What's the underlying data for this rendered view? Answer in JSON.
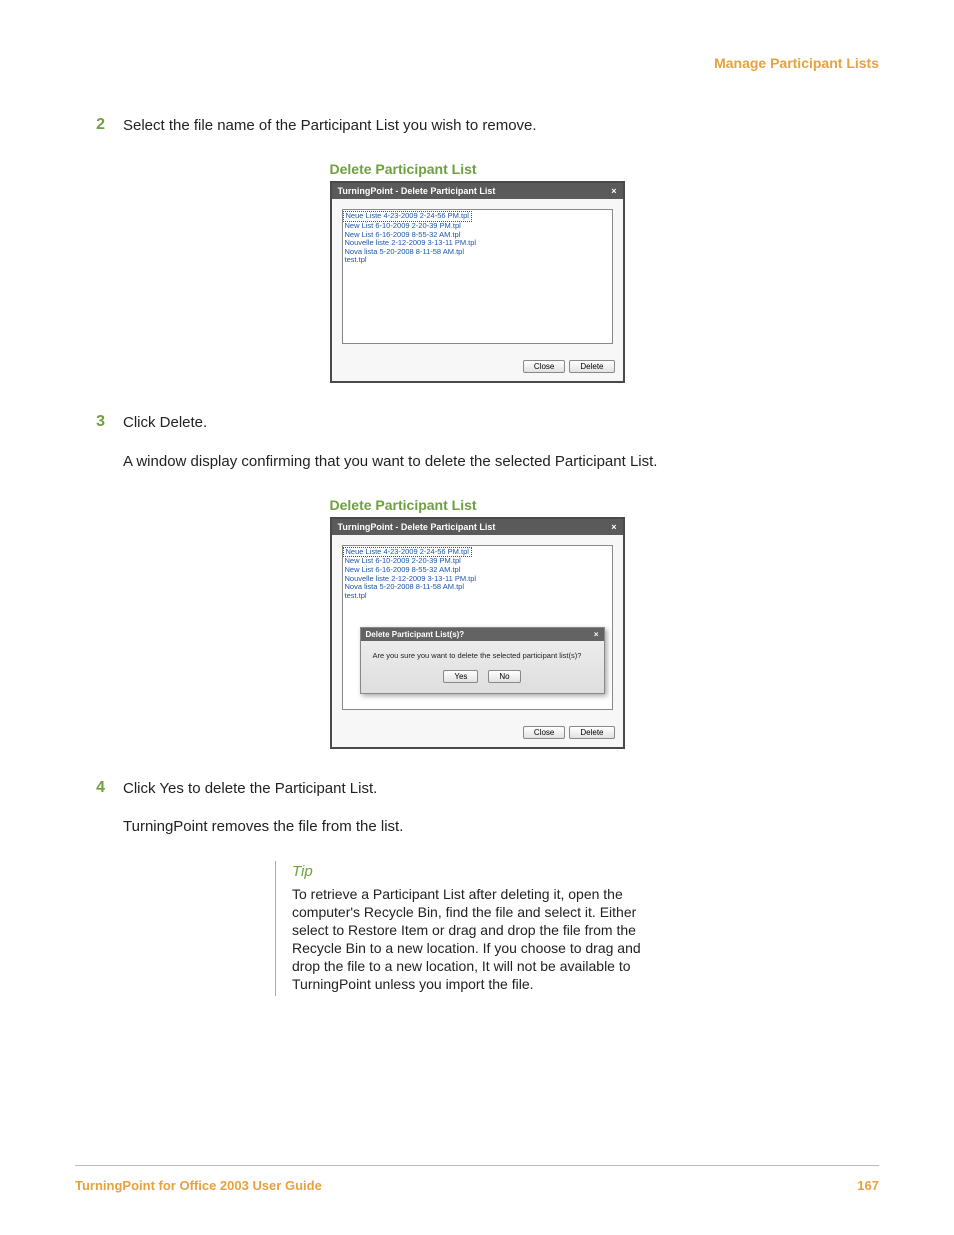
{
  "header": {
    "section_title": "Manage Participant Lists"
  },
  "steps": {
    "s2": {
      "num": "2",
      "text": "Select the file name of the Participant List you wish to remove."
    },
    "s3": {
      "num": "3",
      "text": "Click Delete."
    },
    "s3_followup": "A window display confirming that you want to delete the selected Participant List.",
    "s4": {
      "num": "4",
      "text": "Click Yes to delete the Participant List."
    },
    "s4_followup": "TurningPoint removes the file from the list."
  },
  "figure1": {
    "caption": "Delete Participant List",
    "dialog_title": "TurningPoint - Delete Participant List",
    "close_glyph": "×",
    "list_items": [
      "Neue Liste 4-23-2009 2-24-56 PM.tpl",
      "New List 6-10-2009 2-20-39 PM.tpl",
      "New List 6-16-2009 8-55-32 AM.tpl",
      "Nouvelle liste 2-12-2009 3-13-11 PM.tpl",
      "Nova lista 5-20-2008 8-11-58 AM.tpl",
      "test.tpl"
    ],
    "btn_close": "Close",
    "btn_delete": "Delete"
  },
  "figure2": {
    "caption": "Delete Participant List",
    "dialog_title": "TurningPoint - Delete Participant List",
    "close_glyph": "×",
    "list_items": [
      "Neue Liste 4-23-2009 2-24-56 PM.tpl",
      "New List 6-10-2009 2-20-39 PM.tpl",
      "New List 6-16-2009 8-55-32 AM.tpl",
      "Nouvelle liste 2-12-2009 3-13-11 PM.tpl",
      "Nova lista 5-20-2008 8-11-58 AM.tpl",
      "test.tpl"
    ],
    "btn_close": "Close",
    "btn_delete": "Delete",
    "confirm_title": "Delete Participant List(s)?",
    "confirm_close_glyph": "×",
    "confirm_msg": "Are you sure you want to delete the selected participant list(s)?",
    "btn_yes": "Yes",
    "btn_no": "No"
  },
  "tip": {
    "heading": "Tip",
    "text": "To retrieve a Participant List after deleting it, open the computer's Recycle Bin, find the file and select it. Either select to Restore Item or drag and drop the file from the Recycle Bin to a new location. If you choose to drag and drop the file to a new location, It will not be available to TurningPoint unless you import the file."
  },
  "footer": {
    "left": "TurningPoint for Office 2003 User Guide",
    "right": "167"
  }
}
